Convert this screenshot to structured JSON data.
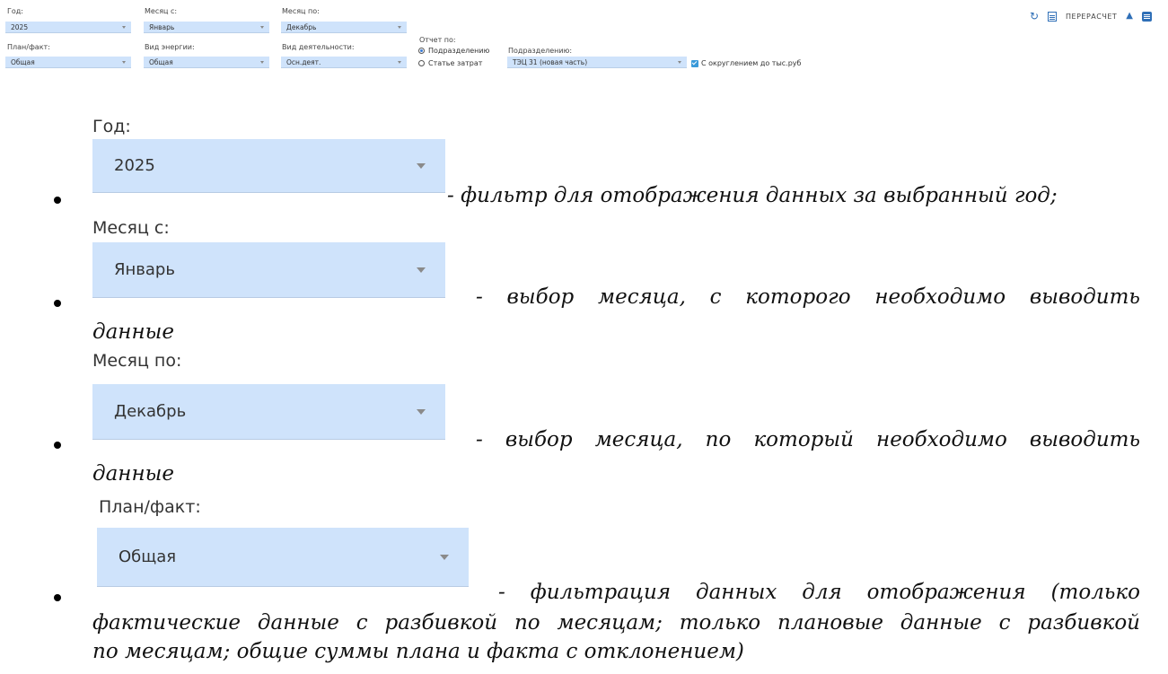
{
  "filter_bar": {
    "year": {
      "label": "Год:",
      "value": "2025"
    },
    "month_from": {
      "label": "Месяц с:",
      "value": "Январь"
    },
    "month_to": {
      "label": "Месяц по:",
      "value": "Декабрь"
    },
    "plan_fact": {
      "label": "План/факт:",
      "value": "Общая"
    },
    "energy_type": {
      "label": "Вид энергии:",
      "value": "Общая"
    },
    "activity_type": {
      "label": "Вид деятельности:",
      "value": "Осн.деят."
    },
    "report_by": {
      "label": "Отчет по:",
      "options": [
        "Подразделению",
        "Статье затрат"
      ],
      "selected": "Подразделению"
    },
    "subdivision": {
      "label": "Подразделению:",
      "value": "ТЭЦ 31 (новая часть)"
    },
    "rounding": {
      "label": "С округлением до тыс.руб",
      "checked": true
    },
    "toolbar": {
      "recalc_label": "ПЕРЕРАСЧЕТ",
      "icons": [
        "refresh-icon",
        "calculator-icon",
        "sort-icon",
        "table-icon"
      ]
    }
  },
  "items": [
    {
      "label": "Год:",
      "value": "2025",
      "desc": "- фильтр для отображения данных за выбранный год;"
    },
    {
      "label": "Месяц с:",
      "value": "Январь",
      "desc_words": [
        "-",
        "выбор",
        "месяца,",
        "с",
        "которого",
        "необходимо",
        "выводить"
      ],
      "desc_cont": "данные"
    },
    {
      "label": "Месяц по:",
      "value": "Декабрь",
      "desc_words": [
        "-",
        "выбор",
        "месяца,",
        "по",
        "который",
        "необходимо",
        "выводить"
      ],
      "desc_cont": "данные"
    },
    {
      "label": "План/факт:",
      "value": "Общая",
      "desc_words": [
        "-",
        "фильтрация",
        "данных",
        "для",
        "отображения",
        "(только"
      ],
      "desc_line2": "фактические данные с разбивкой по месяцам; только плановые данные с разбивкой",
      "desc_line3": "по месяцам; общие суммы плана и факта с отклонением)"
    }
  ]
}
